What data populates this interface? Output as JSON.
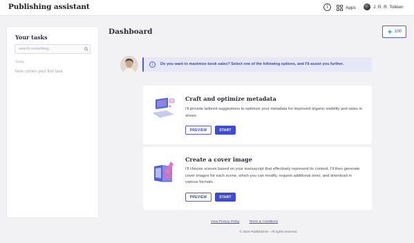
{
  "header": {
    "app_title": "Publishing assistant",
    "info_icon": "info-icon",
    "apps_icon": "grid-icon",
    "apps_label": "Apps",
    "user_avatar_icon": "user-avatar",
    "user_name": "J. R. R. Tolkien"
  },
  "sidebar": {
    "title": "Your tasks",
    "search_placeholder": "search something...",
    "search_icon": "search-icon",
    "group_label": "Today",
    "empty_text": "here comes your first task"
  },
  "main": {
    "title": "Dashboard",
    "credits": {
      "icon": "sparkle-icon",
      "value": "100"
    },
    "prompt": {
      "icon": "info-icon",
      "text": "Do you want to maximize book sales? Select one of the following options, and I'll assist you further."
    },
    "cards": [
      {
        "icon": "metadata-laptop-icon",
        "title": "Craft and optimize metadata",
        "description": "I'll provide tailored suggestions to optimize your metadata for improved organic visibility and sales in stores.",
        "preview_label": "PREVIEW",
        "start_label": "START"
      },
      {
        "icon": "cover-book-icon",
        "title": "Create a cover image",
        "description": "I'll choose scenes based on your manuscript that effectively represent its content. I'll then generate cover images for each scene, which you can modify, request additional ones, and download in various formats.",
        "preview_label": "PREVIEW",
        "start_label": "START"
      }
    ]
  },
  "footer": {
    "privacy_label": "View Privacy Policy",
    "terms_label": "Terms & Conditions",
    "copyright": "© 2024 PublishDrive - All rights reserved."
  },
  "colors": {
    "accent": "#3f4bd3",
    "prompt_bg": "#e6e8f8",
    "page_bg": "#f2f2f4",
    "card_bg": "#ffffff"
  }
}
